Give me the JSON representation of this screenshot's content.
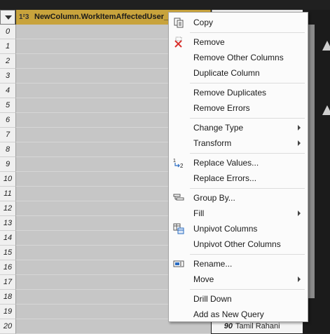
{
  "grid": {
    "column_header": {
      "type_glyph": "1²3",
      "name": "NewColumn.WorkItemAffectedUser_U"
    },
    "row_numbers": [
      "0",
      "1",
      "2",
      "3",
      "4",
      "5",
      "6",
      "7",
      "8",
      "9",
      "10",
      "11",
      "12",
      "13",
      "14",
      "15",
      "16",
      "17",
      "18",
      "19",
      "20"
    ],
    "last_row": {
      "value": "90",
      "text": "Tamil Rahani"
    }
  },
  "context_menu": {
    "items": [
      {
        "label": "Copy",
        "icon": "copy-icon",
        "submenu": false
      },
      {
        "label": "Remove",
        "icon": "remove-icon",
        "submenu": false
      },
      {
        "label": "Remove Other Columns",
        "icon": "",
        "submenu": false
      },
      {
        "label": "Duplicate Column",
        "icon": "",
        "submenu": false
      },
      {
        "label": "Remove Duplicates",
        "icon": "",
        "submenu": false
      },
      {
        "label": "Remove Errors",
        "icon": "",
        "submenu": false
      },
      {
        "label": "Change Type",
        "icon": "",
        "submenu": true
      },
      {
        "label": "Transform",
        "icon": "",
        "submenu": true
      },
      {
        "label": "Replace Values...",
        "icon": "replace-values-icon",
        "submenu": false
      },
      {
        "label": "Replace Errors...",
        "icon": "",
        "submenu": false
      },
      {
        "label": "Group By...",
        "icon": "group-by-icon",
        "submenu": false
      },
      {
        "label": "Fill",
        "icon": "",
        "submenu": true
      },
      {
        "label": "Unpivot Columns",
        "icon": "unpivot-icon",
        "submenu": false
      },
      {
        "label": "Unpivot Other Columns",
        "icon": "",
        "submenu": false
      },
      {
        "label": "Rename...",
        "icon": "rename-icon",
        "submenu": false
      },
      {
        "label": "Move",
        "icon": "",
        "submenu": true
      },
      {
        "label": "Drill Down",
        "icon": "",
        "submenu": false
      },
      {
        "label": "Add as New Query",
        "icon": "",
        "submenu": false
      }
    ]
  }
}
